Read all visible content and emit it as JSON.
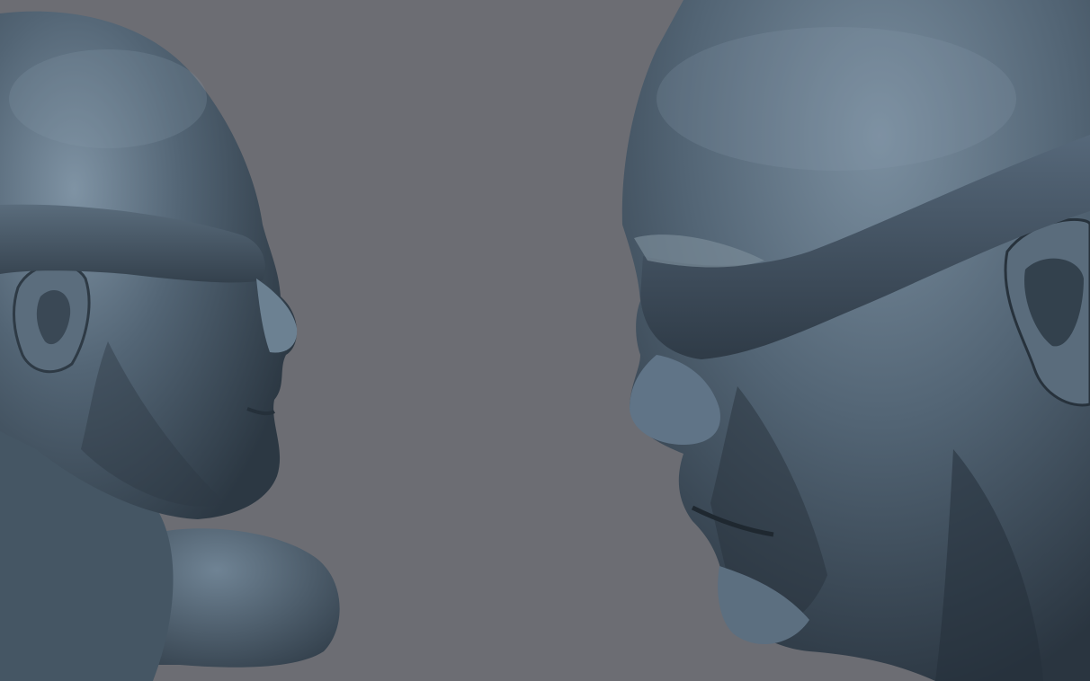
{
  "viewport": {
    "background_color": "#6c6d73",
    "sculpt_base_color": "#4a5a68",
    "sculpt_shadow_color": "#263039",
    "sculpt_highlight_color": "#7f93a4"
  },
  "scene": {
    "models": [
      {
        "semantic": "left-blindfolded-head-bust-sculpt",
        "facing": "right"
      },
      {
        "semantic": "right-blindfolded-head-sculpt",
        "facing": "left"
      }
    ]
  }
}
